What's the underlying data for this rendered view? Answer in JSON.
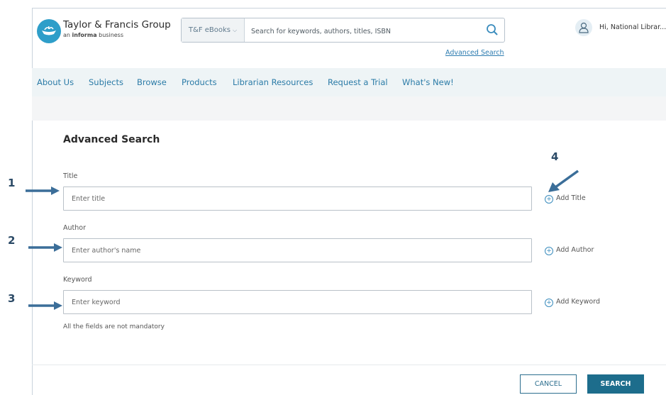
{
  "header": {
    "brand_name": "Taylor & Francis Group",
    "brand_sub_prefix": "an ",
    "brand_sub_bold": "informa",
    "brand_sub_suffix": " business",
    "search_scope": "T&F eBooks",
    "search_placeholder": "Search for keywords, authors, titles, ISBN",
    "advanced_search_link": "Advanced Search",
    "user_greeting": "Hi, National Librar... ⌄"
  },
  "nav": {
    "items": [
      "About Us",
      "Subjects",
      "Browse",
      "Products",
      "Librarian Resources",
      "Request a Trial",
      "What's New!"
    ]
  },
  "form": {
    "title": "Advanced Search",
    "fields": [
      {
        "label": "Title",
        "placeholder": "Enter title",
        "add_label": "Add Title"
      },
      {
        "label": "Author",
        "placeholder": "Enter author's name",
        "add_label": "Add Author"
      },
      {
        "label": "Keyword",
        "placeholder": "Enter keyword",
        "add_label": "Add Keyword"
      }
    ],
    "note": "All the fields are not mandatory",
    "cancel_label": "CANCEL",
    "search_label": "SEARCH"
  },
  "annotations": {
    "labels": [
      "1",
      "2",
      "3",
      "4"
    ],
    "color": "#2b4a66"
  },
  "colors": {
    "accent": "#2b7ba7",
    "primary_button": "#1d6d8c",
    "logo": "#2e9ec9",
    "nav_background": "#eef4f6"
  }
}
